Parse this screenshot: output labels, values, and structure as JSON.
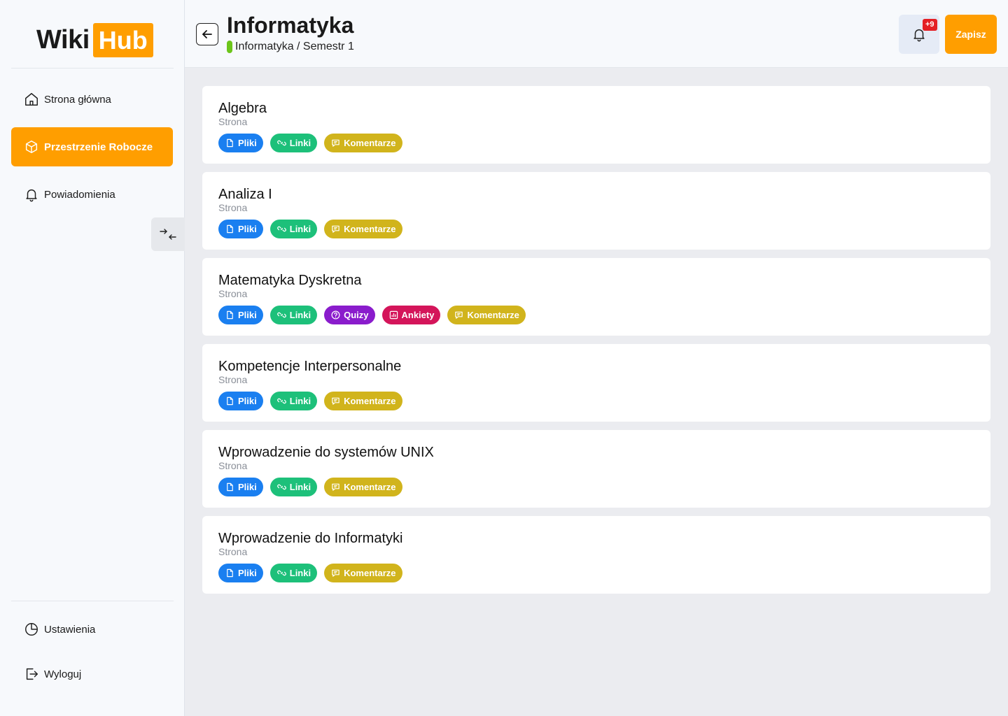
{
  "logo": {
    "part1": "Wiki",
    "part2": "Hub"
  },
  "sidebar": {
    "nav": [
      {
        "label": "Strona główna",
        "icon": "home-icon"
      },
      {
        "label": "Przestrzenie Robocze",
        "icon": "box-icon",
        "active": true
      },
      {
        "label": "Powiadomienia",
        "icon": "bell-icon"
      }
    ],
    "bottom": [
      {
        "label": "Ustawienia",
        "icon": "pie-chart-icon"
      },
      {
        "label": "Wyloguj",
        "icon": "logout-icon"
      }
    ]
  },
  "header": {
    "title": "Informatyka",
    "breadcrumb": "Informatyka / Semestr 1",
    "notification_count": "+9",
    "save_label": "Zapisz"
  },
  "cards": [
    {
      "title": "Algebra",
      "subtitle": "Strona",
      "tags": [
        "Pliki",
        "Linki",
        "Komentarze"
      ]
    },
    {
      "title": "Analiza I",
      "subtitle": "Strona",
      "tags": [
        "Pliki",
        "Linki",
        "Komentarze"
      ]
    },
    {
      "title": "Matematyka Dyskretna",
      "subtitle": "Strona",
      "tags": [
        "Pliki",
        "Linki",
        "Quizy",
        "Ankiety",
        "Komentarze"
      ]
    },
    {
      "title": "Kompetencje Interpersonalne",
      "subtitle": "Strona",
      "tags": [
        "Pliki",
        "Linki",
        "Komentarze"
      ]
    },
    {
      "title": "Wprowadzenie do systemów UNIX",
      "subtitle": "Strona",
      "tags": [
        "Pliki",
        "Linki",
        "Komentarze"
      ]
    },
    {
      "title": "Wprowadzenie do Informatyki",
      "subtitle": "Strona",
      "tags": [
        "Pliki",
        "Linki",
        "Komentarze"
      ]
    }
  ],
  "colors": {
    "accent": "#ff9e00",
    "files": "#1a7ff0",
    "links": "#1dc07a",
    "quiz": "#8a1ccc",
    "polls": "#d4155a",
    "comments": "#d1b41c",
    "badge": "#e41f25"
  }
}
